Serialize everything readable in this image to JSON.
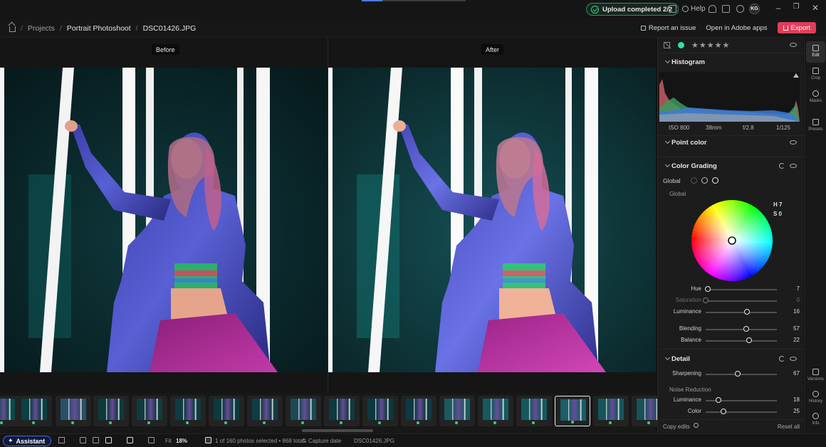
{
  "titlebar": {
    "upload_status": "Upload completed 2/2",
    "help_label": "Help",
    "user_initials": "KG",
    "upload_progress": 0.2
  },
  "breadcrumb": {
    "items": [
      "Projects",
      "Portrait Photoshoot",
      "DSC01426.JPG"
    ]
  },
  "top_actions": {
    "report_issue": "Report an issue",
    "open_in_adobe": "Open in Adobe apps",
    "export": "Export"
  },
  "viewer": {
    "before_label": "Before",
    "after_label": "After"
  },
  "panel": {
    "histogram": {
      "title": "Histogram",
      "exif": [
        "ISO 800",
        "38mm",
        "f/2.8",
        "1/125"
      ]
    },
    "point_color": {
      "title": "Point color"
    },
    "color_grading": {
      "title": "Color Grading",
      "mode_label": "Global",
      "wheel_label": "Global",
      "hue_readout": "H 7",
      "sat_readout": "S 0",
      "sliders": [
        {
          "label": "Hue",
          "value": "7",
          "dim": false,
          "pos": 0.03
        },
        {
          "label": "Saturation",
          "value": "0",
          "dim": true,
          "pos": 0.0
        },
        {
          "label": "Luminance",
          "value": "16",
          "dim": false,
          "pos": 0.58
        },
        {
          "label": "Blending",
          "value": "57",
          "dim": false,
          "pos": 0.57
        },
        {
          "label": "Balance",
          "value": "22",
          "dim": false,
          "pos": 0.61
        }
      ]
    },
    "detail": {
      "title": "Detail",
      "sharpening": {
        "label": "Sharpening",
        "value": "67",
        "pos": 0.45
      },
      "noise_reduction_label": "Noise Reduction",
      "luminance": {
        "label": "Luminance",
        "value": "18",
        "pos": 0.18
      },
      "color": {
        "label": "Color",
        "value": "25",
        "pos": 0.25
      }
    },
    "footer": {
      "copy_edits": "Copy edits",
      "reset_all": "Reset all"
    },
    "colors": {
      "accent_green": "#2ee59d",
      "export_red": "#e33d5a",
      "assistant_blue": "#4466ff"
    }
  },
  "rail": {
    "items": [
      "Edit",
      "Crop",
      "Masks",
      "Presets",
      "Versions",
      "History",
      "Info"
    ]
  },
  "statusbar": {
    "assistant": "Assistant",
    "fit_label": "Fit",
    "zoom": "18%",
    "selection": "1 of 160 photos selected • 868 total",
    "sort": "Capture date",
    "filename": "DSC01426.JPG"
  },
  "icons": [
    "home-icon",
    "check-icon",
    "bell-icon",
    "help-icon",
    "flag-icon",
    "eye-icon",
    "reset-icon",
    "chevron-down-icon",
    "filter-icon",
    "grid-icon",
    "sparkle-icon"
  ]
}
